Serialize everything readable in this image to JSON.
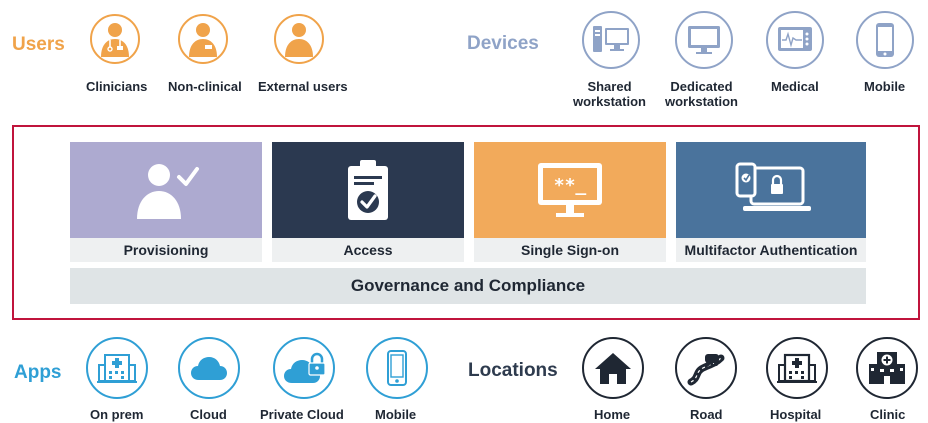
{
  "users": {
    "label": "Users",
    "items": [
      {
        "label": "Clinicians",
        "icon": "clinician-icon"
      },
      {
        "label": "Non-clinical",
        "icon": "badge-person-icon"
      },
      {
        "label": "External users",
        "icon": "person-icon"
      }
    ]
  },
  "devices": {
    "label": "Devices",
    "items": [
      {
        "label_line1": "Shared",
        "label_line2": "workstation",
        "icon": "shared-workstation-icon"
      },
      {
        "label_line1": "Dedicated",
        "label_line2": "workstation",
        "icon": "monitor-icon"
      },
      {
        "label_line1": "Medical",
        "label_line2": "",
        "icon": "medical-monitor-icon"
      },
      {
        "label_line1": "Mobile",
        "label_line2": "",
        "icon": "mobile-phone-icon"
      }
    ]
  },
  "capabilities": {
    "tiles": [
      {
        "label": "Provisioning",
        "color": "#adaad0",
        "icon": "person-check-icon"
      },
      {
        "label": "Access",
        "color": "#2b3950",
        "icon": "clipboard-check-icon"
      },
      {
        "label": "Single Sign-on",
        "color": "#f2aa5b",
        "icon": "password-monitor-icon"
      },
      {
        "label": "Multifactor Authentication",
        "color": "#4a739c",
        "icon": "phone-laptop-lock-icon"
      }
    ],
    "password_text": "**_",
    "governance": "Governance and Compliance",
    "frame_color": "#c0143c"
  },
  "apps": {
    "label": "Apps",
    "items": [
      {
        "label": "On prem",
        "icon": "hospital-building-icon"
      },
      {
        "label": "Cloud",
        "icon": "cloud-icon"
      },
      {
        "label": "Private Cloud",
        "icon": "cloud-lock-icon"
      },
      {
        "label": "Mobile",
        "icon": "mobile-phone-icon"
      }
    ]
  },
  "locations": {
    "label": "Locations",
    "items": [
      {
        "label": "Home",
        "icon": "house-icon"
      },
      {
        "label": "Road",
        "icon": "car-road-icon"
      },
      {
        "label": "Hospital",
        "icon": "hospital-icon"
      },
      {
        "label": "Clinic",
        "icon": "clinic-icon"
      }
    ]
  },
  "colors": {
    "users": "#f0a34a",
    "devices": "#8fa3c7",
    "apps": "#2f9fd5",
    "locations": "#1f2733"
  }
}
